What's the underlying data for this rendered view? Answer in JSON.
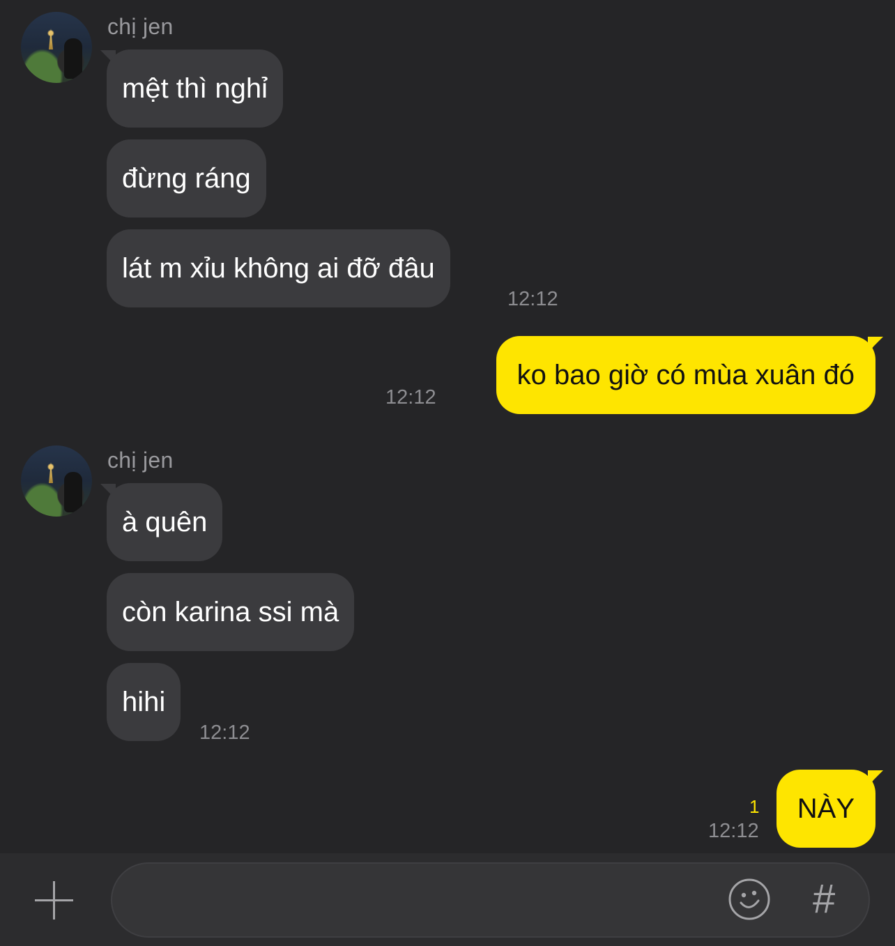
{
  "conversation": {
    "groups": [
      {
        "sender": "chị jen",
        "messages": [
          "mệt thì nghỉ",
          "đừng ráng",
          "lát m xỉu không ai đỡ đâu"
        ],
        "time": "12:12"
      },
      {
        "outgoing_message": "ko bao giờ có mùa xuân đó",
        "time": "12:12"
      },
      {
        "sender": "chị jen",
        "messages": [
          "à quên",
          "còn karina ssi mà",
          "hihi"
        ],
        "time": "12:12"
      },
      {
        "outgoing_message": "NÀY",
        "time": "12:12",
        "unread_count": "1"
      }
    ]
  },
  "input_bar": {
    "message_value": "",
    "icons": [
      "plus-icon",
      "emoji-icon",
      "hashtag-icon"
    ],
    "hash_glyph": "#"
  },
  "colors": {
    "background": "#252527",
    "incoming_bubble": "#3b3b3e",
    "outgoing_bubble": "#fee500",
    "timestamp": "#8e8e92"
  }
}
